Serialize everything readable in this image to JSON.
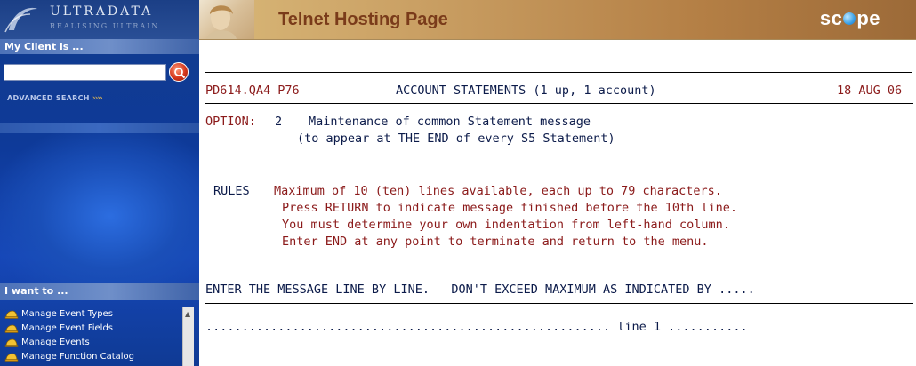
{
  "sidebar": {
    "brand_name": "ULTRADATA",
    "brand_tagline": "REALISING ULTRAIN",
    "my_client_label": "My Client is ...",
    "search": {
      "placeholder": "",
      "value": ""
    },
    "advanced_search_label": "ADVANCED SEARCH",
    "advanced_search_arrows": "››››",
    "i_want_label": "I want to ...",
    "menu_items": [
      {
        "label": "Manage Event Types",
        "icon": "hardhat-icon"
      },
      {
        "label": "Manage Event Fields",
        "icon": "hardhat-icon"
      },
      {
        "label": "Manage Events",
        "icon": "hardhat-icon"
      },
      {
        "label": "Manage Function Catalog",
        "icon": "hardhat-icon"
      }
    ]
  },
  "header": {
    "title": "Telnet Hosting Page",
    "logo": {
      "before": "sc",
      "after": "pe"
    }
  },
  "terminal": {
    "screen_id": "PD614.QA4 P76",
    "screen_title": "ACCOUNT STATEMENTS (1 up, 1 account)",
    "date": "18 AUG 06",
    "option_label": "OPTION:",
    "option_number": "2",
    "option_text": "Maintenance of common Statement message",
    "option_subtext": "(to appear at THE END of every S5 Statement)",
    "rules_label": "RULES",
    "rules": [
      "Maximum of 10 (ten) lines available, each up to 79 characters.",
      "Press RETURN to indicate message finished before the 10th line.",
      "You must determine your own indentation from left-hand column.",
      "Enter END at any point to terminate and return to the menu."
    ],
    "entry_instruction": "ENTER THE MESSAGE LINE BY LINE.   DON'T EXCEED MAXIMUM AS INDICATED BY .....",
    "entry_line": "........................................................ line 1 ..........."
  },
  "colors": {
    "sidebar_blue": "#0e3a99",
    "header_tan": "#caa064",
    "terminal_red": "#8b1a1a",
    "terminal_navy": "#0c1b4a"
  }
}
